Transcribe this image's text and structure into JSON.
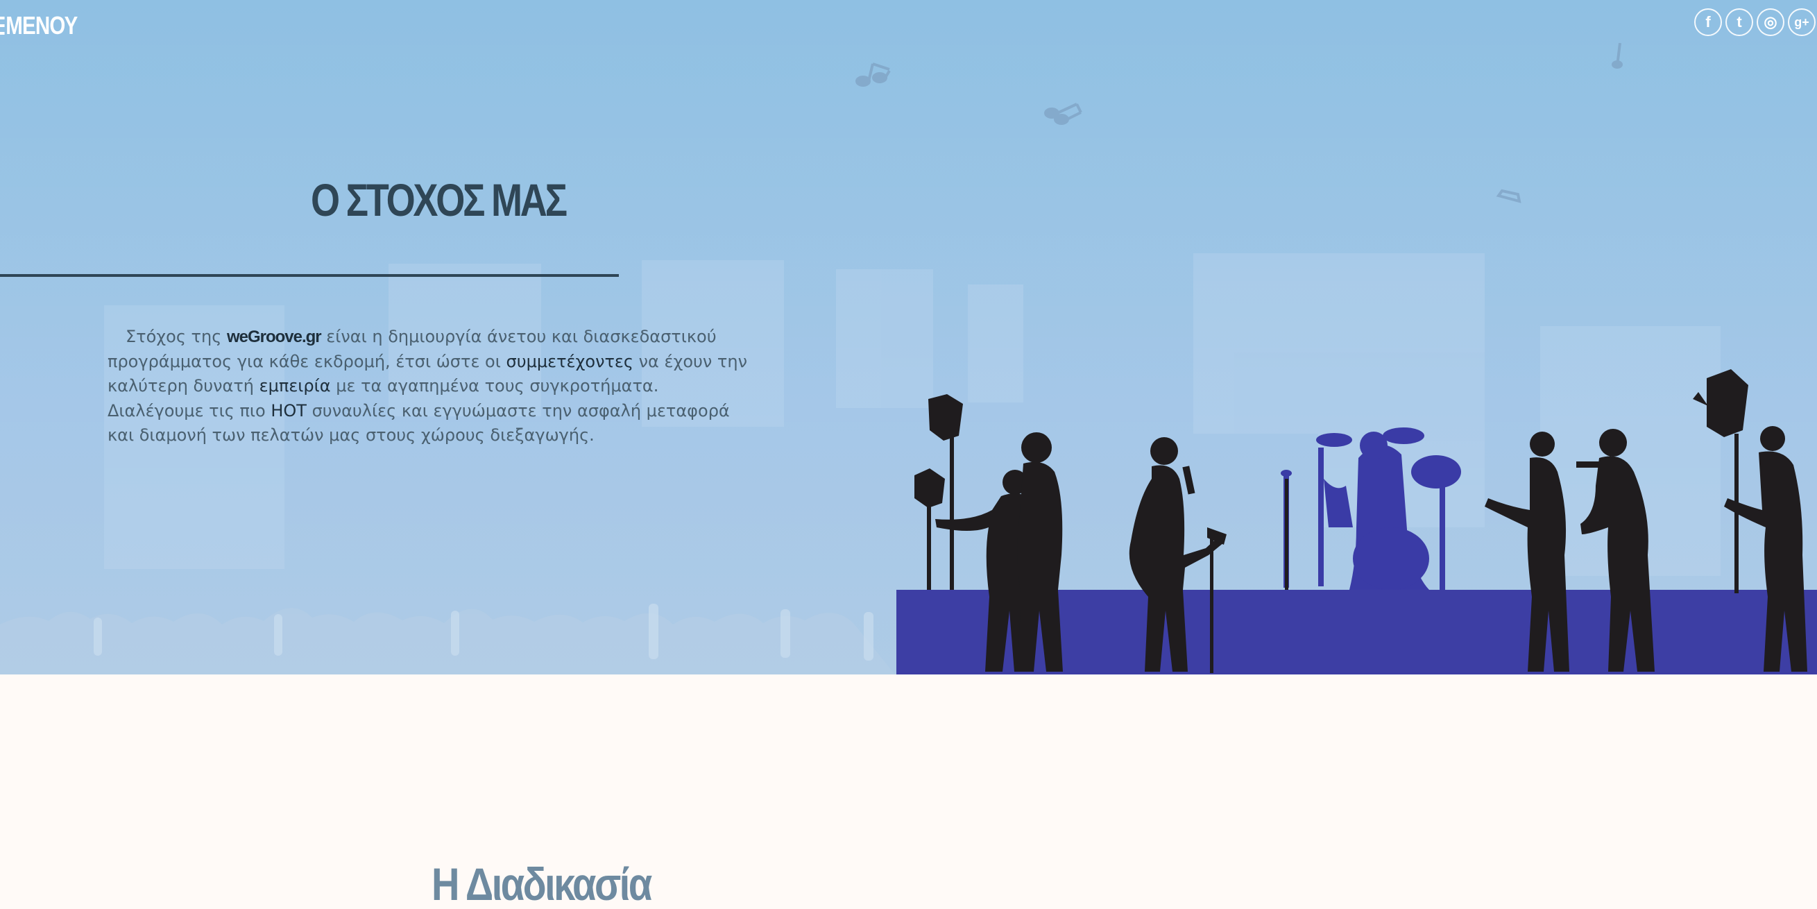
{
  "header": {
    "menu_label": "ΜΕΝΟΥ",
    "social": [
      {
        "icon": "facebook-icon",
        "glyph": "f"
      },
      {
        "icon": "twitter-icon",
        "glyph": "t"
      },
      {
        "icon": "instagram-icon",
        "glyph": "◎"
      },
      {
        "icon": "google-plus-icon",
        "glyph": "g+"
      }
    ]
  },
  "goal": {
    "title": "Ο ΣΤΟΧΟΣ ΜΑΣ",
    "text_1": "Στόχος της ",
    "brand": "weGroove.gr",
    "text_2": " είναι η δημιουργία άνετου και διασκεδαστικού προγράμματος για κάθε εκδρομή, έτσι ώστε οι ",
    "em_1": "συμμετέχοντες",
    "text_3": " να έχουν την καλύτερη δυνατή ",
    "em_2": "εμπειρία",
    "text_4": " με τα αγαπημένα τους συγκροτήματα. Διαλέγουμε τις πιο ",
    "em_3": "HOT",
    "text_5": " συναυλίες και εγγυώμαστε την ασφαλή μεταφορά και διαμονή των πελατών μας στους χώρους διεξαγωγής."
  },
  "process": {
    "title": "Η Διαδικασία"
  },
  "colors": {
    "hero_sky": "#96c2e4",
    "stage": "#3d3ea4",
    "silhouette": "#1f1c1e",
    "drum_kit": "#3a3ba6",
    "title_dark": "#2f4656",
    "process_title": "#6e8aa0",
    "page_bg": "#fffaf7"
  }
}
